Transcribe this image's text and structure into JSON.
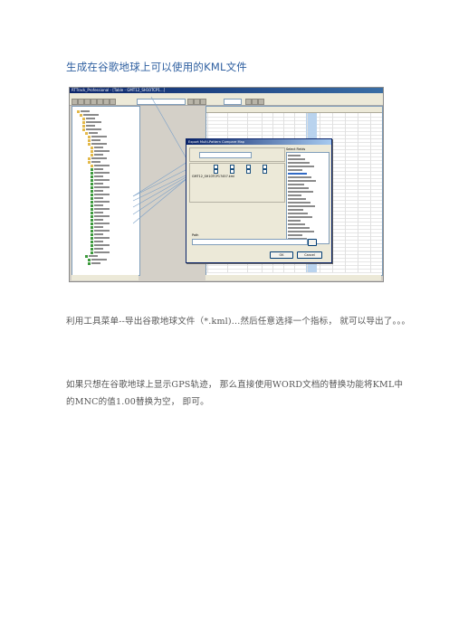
{
  "title": "生成在谷歌地球上可以使用的KML文件",
  "screenshot": {
    "window_title": "RTTrack_Professional - [Table - GMT12_SH10TCP1...]",
    "dialog_title": "Export Multi-Pattern Compare Map",
    "file_name": "GMT12_SH10TCP17457.kml",
    "select_fields_label": "Select Fields",
    "path_label": "Path",
    "ok_label": "OK",
    "cancel_label": "Cancel"
  },
  "paragraph1": "利用工具菜单--导出谷歌地球文件（*.kml)...然后任意选择一个指标，  就可以导出了。。。",
  "paragraph2_line1": "如果只想在谷歌地球上显示GPS轨迹，  那么直接使用WORD文档的替换功能将KML中",
  "paragraph2_line2": "的MNC的值1.00替换为空，   即可。"
}
